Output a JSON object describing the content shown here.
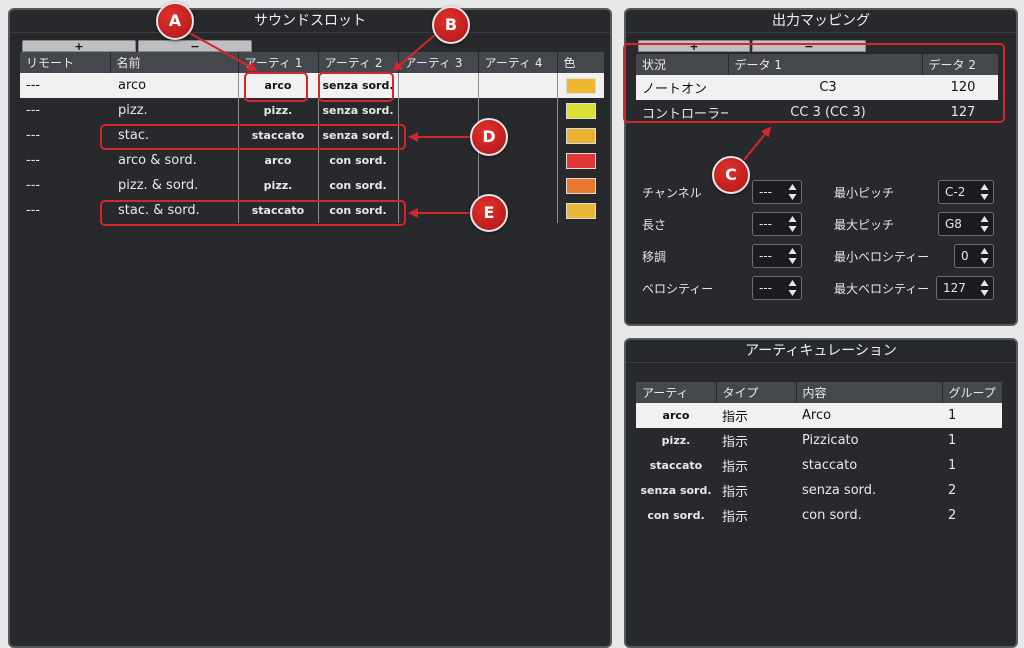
{
  "sound_slot": {
    "title": "サウンドスロット",
    "plus": "+",
    "minus": "−",
    "columns": [
      "リモート",
      "名前",
      "アーティ 1",
      "アーティ 2",
      "アーティ 3",
      "アーティ 4",
      "色"
    ],
    "rows": [
      {
        "remote": "---",
        "name": "arco",
        "a1": "arco",
        "a2": "senza sord.",
        "a3": "",
        "a4": "",
        "color": "#f0b830",
        "selected": true
      },
      {
        "remote": "---",
        "name": "pizz.",
        "a1": "pizz.",
        "a2": "senza sord.",
        "a3": "",
        "a4": "",
        "color": "#d8e038",
        "selected": false
      },
      {
        "remote": "---",
        "name": "stac.",
        "a1": "staccato",
        "a2": "senza sord.",
        "a3": "",
        "a4": "",
        "color": "#e8b030",
        "selected": false
      },
      {
        "remote": "---",
        "name": "arco & sord.",
        "a1": "arco",
        "a2": "con sord.",
        "a3": "",
        "a4": "",
        "color": "#e03838",
        "selected": false
      },
      {
        "remote": "---",
        "name": "pizz. & sord.",
        "a1": "pizz.",
        "a2": "con sord.",
        "a3": "",
        "a4": "",
        "color": "#e87830",
        "selected": false
      },
      {
        "remote": "---",
        "name": "stac. & sord.",
        "a1": "staccato",
        "a2": "con sord.",
        "a3": "",
        "a4": "",
        "color": "#e8b838",
        "selected": false
      }
    ]
  },
  "output_mapping": {
    "title": "出力マッピング",
    "plus": "+",
    "minus": "−",
    "columns": [
      "状況",
      "データ 1",
      "データ 2"
    ],
    "rows": [
      {
        "status": "ノートオン",
        "data1": "C3",
        "data2": "120",
        "selected": true
      },
      {
        "status": "コントローラー",
        "data1": "CC 3  (CC 3)",
        "data2": "127",
        "selected": false
      }
    ],
    "fields": {
      "channel": {
        "label": "チャンネル",
        "value": "---"
      },
      "length": {
        "label": "長さ",
        "value": "---"
      },
      "transpose": {
        "label": "移調",
        "value": "---"
      },
      "velocity": {
        "label": "ベロシティー",
        "value": "---"
      },
      "min_pitch": {
        "label": "最小ピッチ",
        "value": "C-2"
      },
      "max_pitch": {
        "label": "最大ピッチ",
        "value": "G8"
      },
      "min_velocity": {
        "label": "最小ベロシティー",
        "value": "0"
      },
      "max_velocity": {
        "label": "最大ベロシティー",
        "value": "127"
      }
    }
  },
  "articulation": {
    "title": "アーティキュレーション",
    "columns": [
      "アーティ",
      "タイプ",
      "内容",
      "グループ"
    ],
    "rows": [
      {
        "art": "arco",
        "type": "指示",
        "content": "Arco",
        "group": "1",
        "selected": true
      },
      {
        "art": "pizz.",
        "type": "指示",
        "content": "Pizzicato",
        "group": "1",
        "selected": false
      },
      {
        "art": "staccato",
        "type": "指示",
        "content": "staccato",
        "group": "1",
        "selected": false
      },
      {
        "art": "senza sord.",
        "type": "指示",
        "content": "senza sord.",
        "group": "2",
        "selected": false
      },
      {
        "art": "con sord.",
        "type": "指示",
        "content": "con sord.",
        "group": "2",
        "selected": false
      }
    ]
  },
  "annotations": {
    "a": "A",
    "b": "B",
    "c": "C",
    "d": "D",
    "e": "E",
    "color": "#d6262a"
  }
}
